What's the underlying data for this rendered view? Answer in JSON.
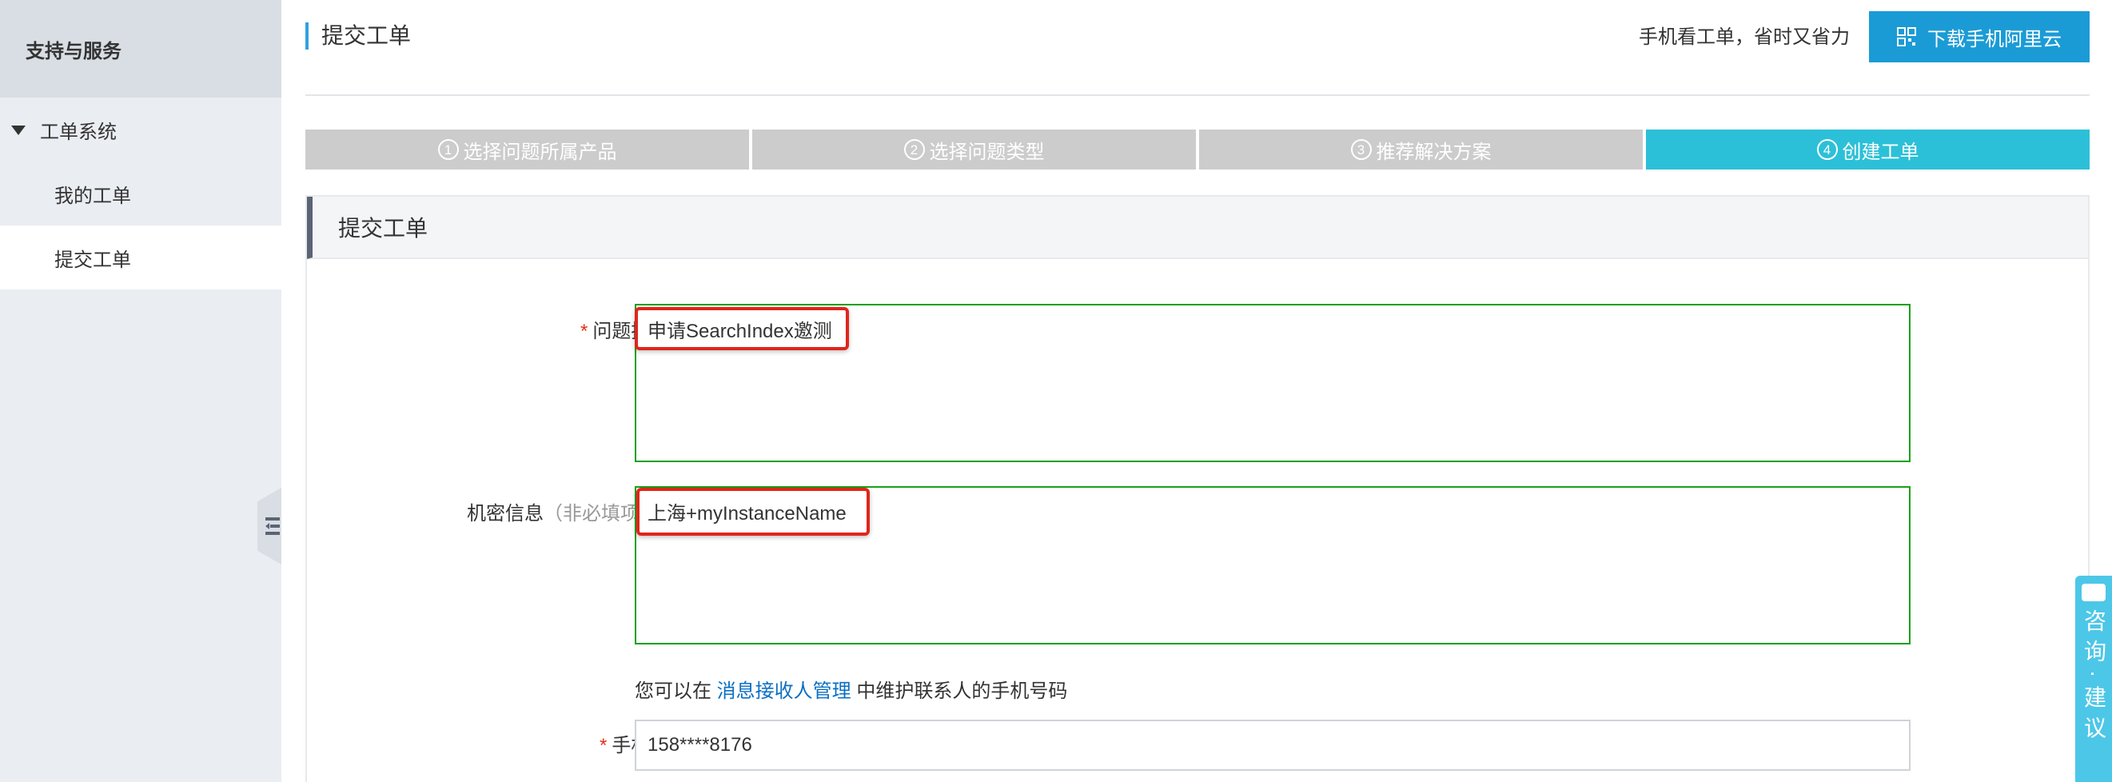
{
  "sidebar": {
    "title": "支持与服务",
    "section": "工单系统",
    "items": [
      {
        "label": "我的工单"
      },
      {
        "label": "提交工单"
      }
    ]
  },
  "header": {
    "page_title": "提交工单",
    "promo_text": "手机看工单，省时又省力",
    "download_button": "下载手机阿里云"
  },
  "steps": [
    {
      "num": "1",
      "label": "选择问题所属产品"
    },
    {
      "num": "2",
      "label": "选择问题类型"
    },
    {
      "num": "3",
      "label": "推荐解决方案"
    },
    {
      "num": "4",
      "label": "创建工单"
    }
  ],
  "form": {
    "heading": "提交工单",
    "description": {
      "required_mark": "*",
      "label": "问题描述:",
      "value": "申请SearchIndex邀测"
    },
    "secret": {
      "label": "机密信息",
      "optional_note": "（非必填项）",
      "value": "上海+myInstanceName"
    },
    "hint": {
      "before": "您可以在 ",
      "link": "消息接收人管理",
      "after": " 中维护联系人的手机号码"
    },
    "phone": {
      "required_mark": "*",
      "label": "手机号:",
      "value": "158****8176"
    }
  },
  "consult_tab": {
    "label": "咨询·建议"
  },
  "colors": {
    "accent": "#1b9bd5",
    "active_step": "#2cc0d8",
    "inactive_step": "#cccccc",
    "highlight": "#e0251b",
    "valid_border": "#1aa11a",
    "required": "#e0311d",
    "link": "#0b6fc4"
  }
}
